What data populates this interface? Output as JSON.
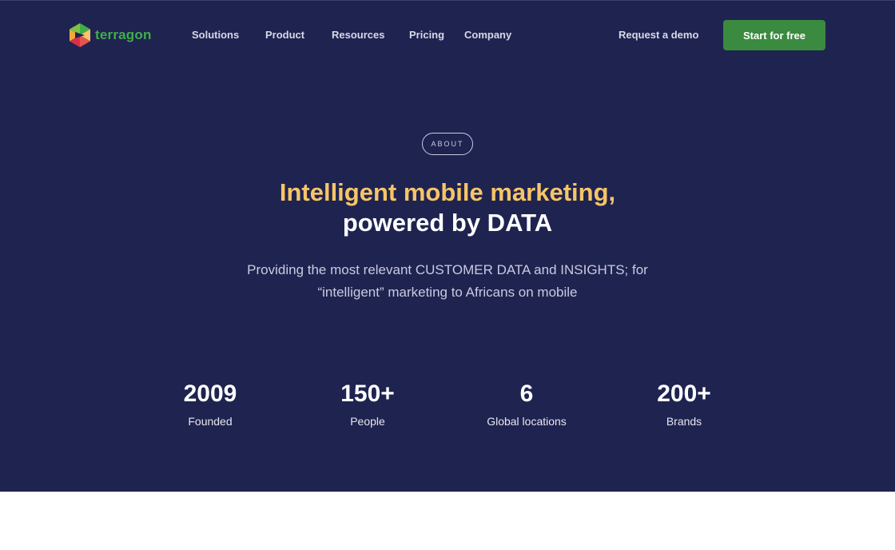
{
  "header": {
    "logo_text": "terragon",
    "nav": [
      "Solutions",
      "Product",
      "Resources",
      "Pricing",
      "Company"
    ],
    "demo_label": "Request a demo",
    "cta_label": "Start for free"
  },
  "hero": {
    "badge": "ABOUT",
    "title_line1": "Intelligent mobile marketing,",
    "title_line2": "powered by DATA",
    "subtitle_line1": "Providing the most relevant CUSTOMER DATA and INSIGHTS; for",
    "subtitle_line2": "“intelligent” marketing to Africans on mobile"
  },
  "stats": [
    {
      "value": "2009",
      "label": "Founded"
    },
    {
      "value": "150+",
      "label": "People"
    },
    {
      "value": "6",
      "label": "Global locations"
    },
    {
      "value": "200+",
      "label": "Brands"
    }
  ],
  "colors": {
    "hero_bg": "#1f2350",
    "accent_yellow": "#f6c567",
    "brand_green": "#3a8a3f"
  }
}
